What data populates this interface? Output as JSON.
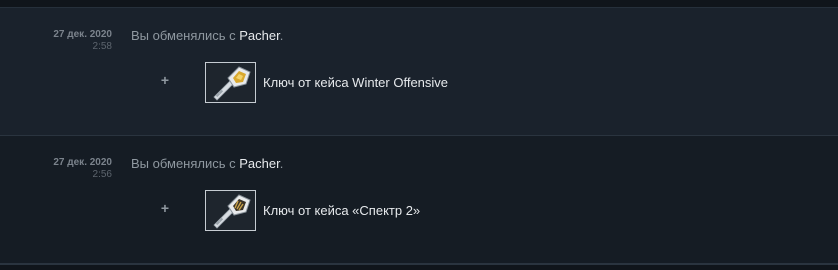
{
  "history": {
    "entries": [
      {
        "date": "27 дек. 2020",
        "time": "2:58",
        "description_prefix": "Вы обменялись с ",
        "partner": "Pacher",
        "description_suffix": ".",
        "change_sign": "+",
        "item_name": "Ключ от кейса Winter Offensive",
        "item_icon": "case-key-winter-offensive-icon"
      },
      {
        "date": "27 дек. 2020",
        "time": "2:56",
        "description_prefix": "Вы обменялись с ",
        "partner": "Pacher",
        "description_suffix": ".",
        "change_sign": "+",
        "item_name": "Ключ от кейса «Спектр 2»",
        "item_icon": "case-key-spectrum-2-icon"
      }
    ]
  },
  "colors": {
    "background": "#131820",
    "row_background_1": "#1a222c",
    "row_background_2": "#151c24",
    "muted_text": "#8f98a0",
    "bright_text": "#e6e9ec"
  }
}
